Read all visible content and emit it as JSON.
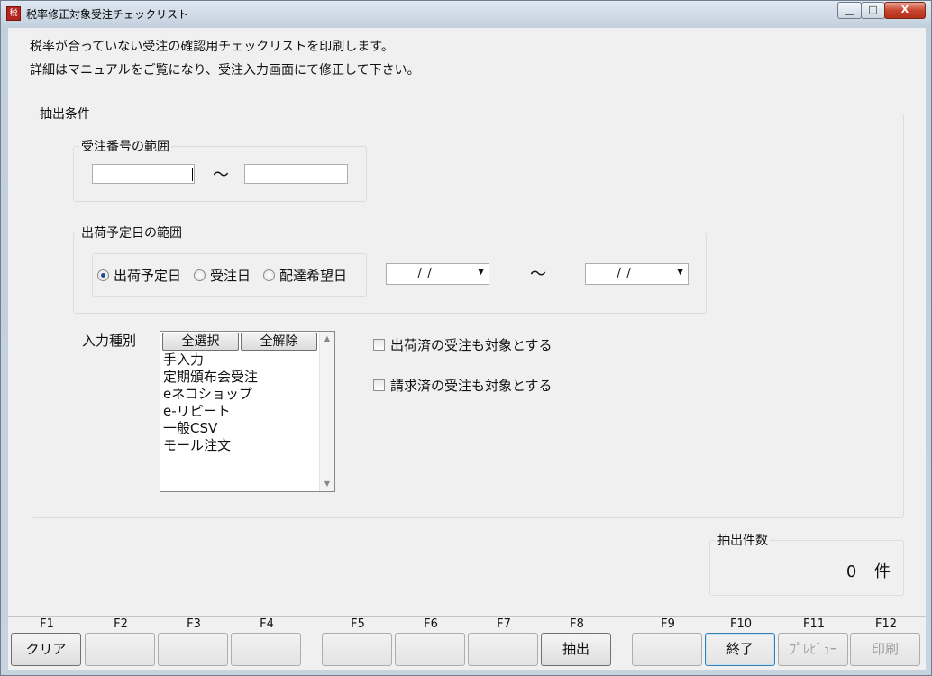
{
  "window": {
    "title": "税率修正対象受注チェックリスト",
    "app_icon": "app-icon",
    "controls": {
      "minimize": "▭",
      "maximize": "□",
      "close": "X"
    }
  },
  "description": {
    "line1": "税率が合っていない受注の確認用チェックリストを印刷します。",
    "line2": "詳細はマニュアルをご覧になり、受注入力画面にて修正して下さい。"
  },
  "extract": {
    "group_label": "抽出条件",
    "order_range": {
      "label": "受注番号の範囲",
      "from_value": "",
      "to_value": "",
      "separator": "～"
    },
    "ship_range": {
      "label": "出荷予定日の範囲",
      "options": [
        "出荷予定日",
        "受注日",
        "配達希望日"
      ],
      "selected": "出荷予定日",
      "from_date": "_/_/_",
      "to_date": "_/_/_",
      "separator": "～"
    },
    "input_type": {
      "label": "入力種別",
      "select_all": "全選択",
      "deselect_all": "全解除",
      "items": [
        "手入力",
        "定期頒布会受注",
        "eネコショップ",
        "e-リピート",
        "一般CSV",
        "モール注文"
      ]
    },
    "options": {
      "include_shipped": "出荷済の受注も対象とする",
      "include_billed": "請求済の受注も対象とする"
    }
  },
  "count": {
    "label": "抽出件数",
    "value": "0",
    "unit": "件"
  },
  "function_keys": [
    {
      "key": "F1",
      "label": "クリア"
    },
    {
      "key": "F2",
      "label": ""
    },
    {
      "key": "F3",
      "label": ""
    },
    {
      "key": "F4",
      "label": ""
    },
    {
      "key": "F5",
      "label": ""
    },
    {
      "key": "F6",
      "label": ""
    },
    {
      "key": "F7",
      "label": ""
    },
    {
      "key": "F8",
      "label": "抽出"
    },
    {
      "key": "F9",
      "label": ""
    },
    {
      "key": "F10",
      "label": "終了"
    },
    {
      "key": "F11",
      "label": "ﾌﾟﾚﾋﾞｭｰ"
    },
    {
      "key": "F12",
      "label": "印刷"
    }
  ]
}
